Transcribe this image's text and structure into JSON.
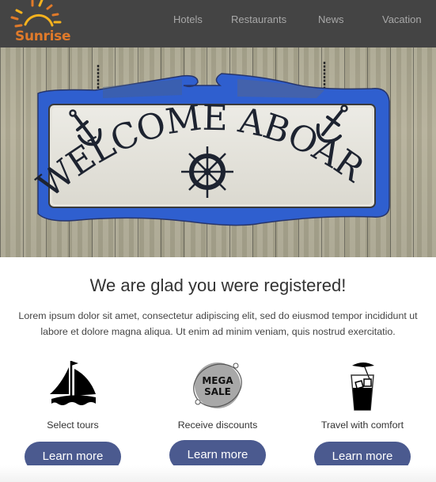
{
  "header": {
    "logo_text": "Sunrise",
    "nav": [
      {
        "label": "Hotels"
      },
      {
        "label": "Restaurants"
      },
      {
        "label": "News"
      },
      {
        "label": "Vacation"
      }
    ]
  },
  "hero": {
    "sign_text": "WELCOME ABOARD",
    "sign_word1": "WELCOME",
    "sign_word2": "ABOARD",
    "icons": [
      "anchor-icon",
      "ship-wheel-icon",
      "anchor-icon"
    ]
  },
  "main": {
    "title": "We are glad you were registered!",
    "lead": "Lorem ipsum dolor sit amet, consectetur adipiscing elit, sed do eiusmod tempor incididunt ut labore et dolore magna aliqua. Ut enim ad minim veniam, quis nostrud exercitatio.",
    "features": [
      {
        "icon": "sailboat-icon",
        "label": "Select tours",
        "button": "Learn more"
      },
      {
        "icon": "mega-sale-badge-icon",
        "label": "Receive discounts",
        "badge_line1": "MEGA",
        "badge_line2": "SALE",
        "button": "Learn more"
      },
      {
        "icon": "cocktail-icon",
        "label": "Travel with comfort",
        "button": "Learn more"
      }
    ]
  },
  "colors": {
    "header_bg": "#444444",
    "nav_text": "#a8a8a8",
    "logo_orange": "#e07a2a",
    "sun_yellow": "#f5b21e",
    "button_bg": "#4b5a8f",
    "button_text": "#ffffff",
    "sign_blue": "#2f5fcf",
    "sign_board": "#e8e6de",
    "sign_ink": "#1d2330"
  }
}
